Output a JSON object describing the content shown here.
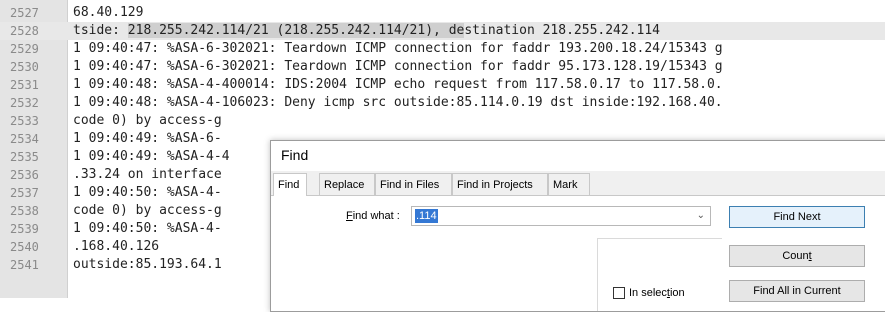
{
  "editor": {
    "lines": [
      {
        "num": "2527",
        "text": "68.40.129"
      },
      {
        "num": "2528",
        "pre": "tside: ",
        "hl": "218.255.242.114/21 (218.255.242.114/21), de",
        "post": "stination 218.255.242.114"
      },
      {
        "num": "2529",
        "text": "1 09:40:47: %ASA-6-302021: Teardown ICMP connection for faddr 193.200.18.24/15343 g"
      },
      {
        "num": "2530",
        "text": "1 09:40:47: %ASA-6-302021: Teardown ICMP connection for faddr 95.173.128.19/15343 g"
      },
      {
        "num": "2531",
        "text": "1 09:40:48: %ASA-4-400014: IDS:2004 ICMP echo request from 117.58.0.17 to 117.58.0."
      },
      {
        "num": "2532",
        "text": "1 09:40:48: %ASA-4-106023: Deny icmp src outside:85.114.0.19 dst inside:192.168.40."
      },
      {
        "num": "2533",
        "text": "code 0) by access-g"
      },
      {
        "num": "2534",
        "text": "1 09:40:49: %ASA-6-"
      },
      {
        "num": "2535",
        "text": "1 09:40:49: %ASA-4-4"
      },
      {
        "num": "2536",
        "text": ".33.24 on interface"
      },
      {
        "num": "2537",
        "text": "1 09:40:50: %ASA-4-"
      },
      {
        "num": "2538",
        "text": "code 0) by access-g"
      },
      {
        "num": "2539",
        "text": "1 09:40:50: %ASA-4-"
      },
      {
        "num": "2540",
        "text": ".168.40.126"
      },
      {
        "num": "2541",
        "text": "outside:85.193.64.1"
      }
    ]
  },
  "find_dialog": {
    "title": "Find",
    "tabs": [
      "Find",
      "Replace",
      "Find in Files",
      "Find in Projects",
      "Mark"
    ],
    "find_what_label_u": "F",
    "find_what_label_rest": "ind what :",
    "find_what_value": ".114",
    "buttons": {
      "find_next": "Find Next",
      "count_pre": "Coun",
      "count_u": "t",
      "find_all_in_current": "Find All in Current"
    },
    "in_selection_pre": "In selec",
    "in_selection_u": "t",
    "in_selection_post": "ion"
  }
}
